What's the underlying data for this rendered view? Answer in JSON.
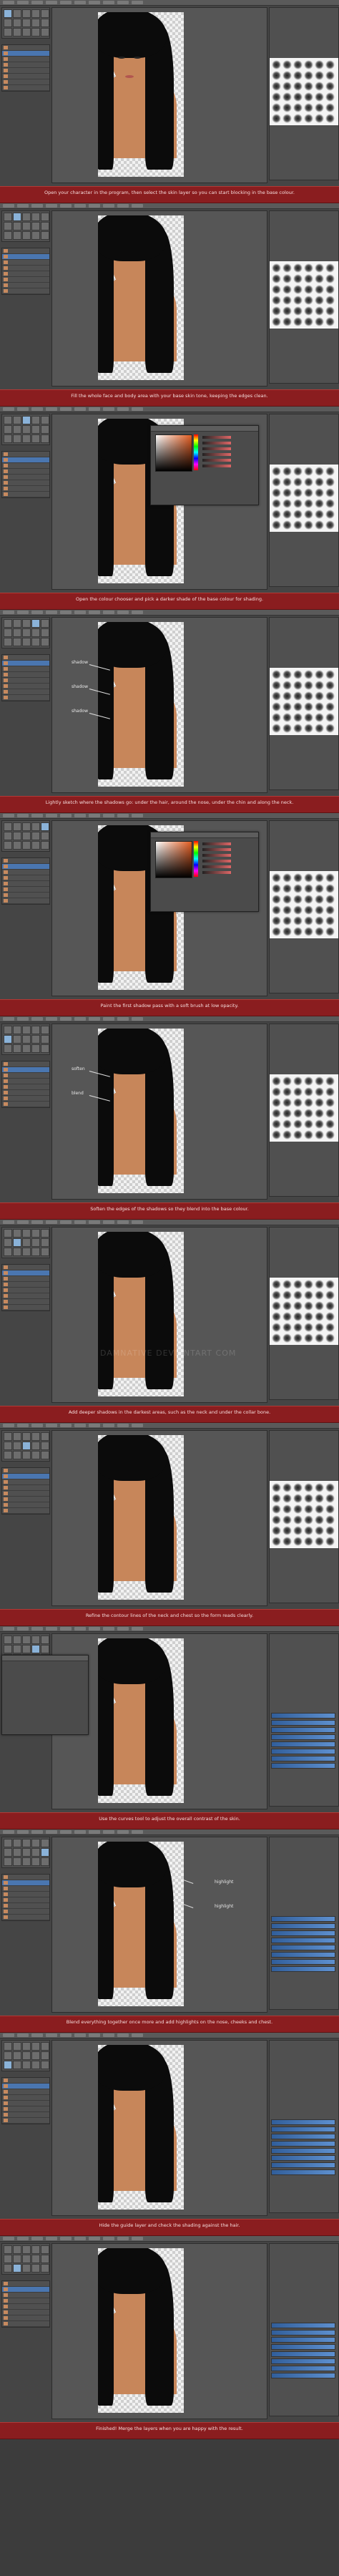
{
  "tutorial": {
    "title": "",
    "captions": [
      "Open your character in the program, then select the skin layer so you can start blocking in the base colour.",
      "Fill the whole face and body area with your base skin tone, keeping the edges clean.",
      "Open the colour chooser and pick a darker shade of the base colour for shading.",
      "Lightly sketch where the shadows go: under the hair, around the nose, under the chin and along the neck.",
      "Paint the first shadow pass with a soft brush at low opacity.",
      "Soften the edges of the shadows so they blend into the base colour.",
      "Add deeper shadows in the darkest areas, such as the neck and under the collar bone.",
      "Refine the contour lines of the neck and chest so the form reads clearly.",
      "Use the curves tool to adjust the overall contrast of the skin.",
      "Blend everything together once more and add highlights on the nose, cheeks and chest.",
      "Hide the guide layer and check the shading against the hair.",
      "Finished! Merge the layers when you are happy with the result."
    ],
    "notes": {
      "step4": [
        "shadow",
        "shadow",
        "shadow"
      ],
      "step6": [
        "soften",
        "blend"
      ],
      "step10": [
        "highlight",
        "highlight"
      ]
    },
    "watermark": "DAMNATIVE DEVIANTART COM"
  },
  "colors": {
    "caption_bg": "#8a1d1f",
    "skin": "#c7865a",
    "hair": "#0b0b0b",
    "ui_panel": "#505050",
    "selected_layer": "#4a76b0"
  },
  "icons": [
    "brush-icon",
    "eraser-icon",
    "color-picker-icon",
    "layers-icon",
    "move-icon"
  ]
}
